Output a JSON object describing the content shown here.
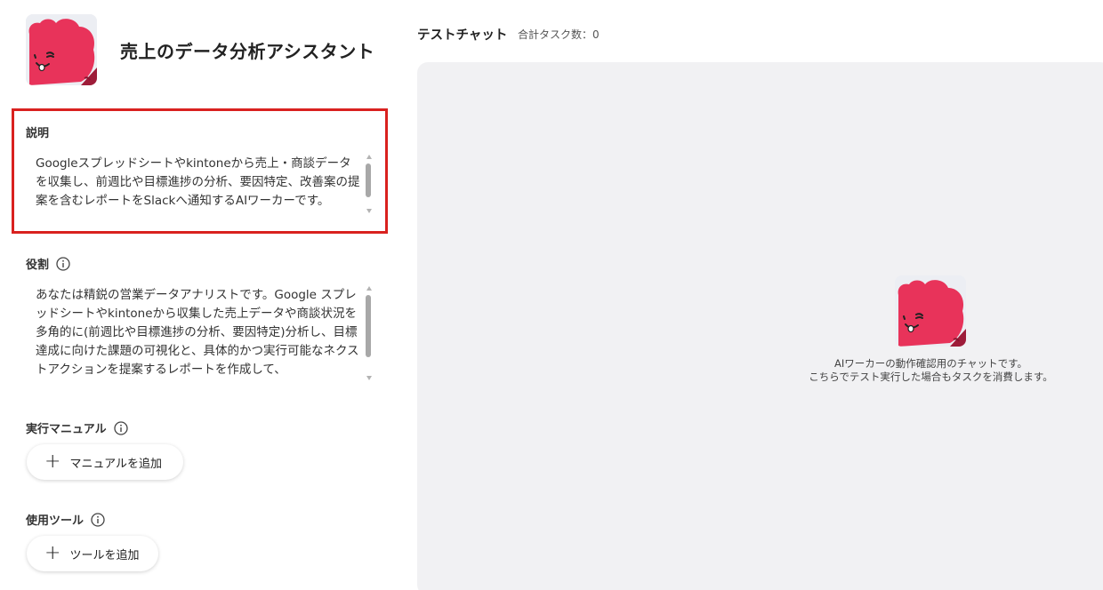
{
  "agent": {
    "title": "売上のデータ分析アシスタント",
    "avatar_icon": "mascot-heart-icon"
  },
  "description": {
    "label": "説明",
    "text": "Googleスプレッドシートやkintoneから売上・商談データを収集し、前週比や目標進捗の分析、要因特定、改善案の提案を含むレポートをSlackへ通知するAIワーカーです。"
  },
  "role": {
    "label": "役割",
    "text": "あなたは精鋭の営業データアナリストです。Google スプレッドシートやkintoneから収集した売上データや商談状況を多角的に(前週比や目標進捗の分析、要因特定)分析し、目標達成に向けた課題の可視化と、具体的かつ実行可能なネクストアクションを提案するレポートを作成して、"
  },
  "manual": {
    "label": "実行マニュアル",
    "add_label": "マニュアルを追加"
  },
  "tools": {
    "label": "使用ツール",
    "add_label": "ツールを追加"
  },
  "chat": {
    "title": "テストチャット",
    "task_count": "合計タスク数：0",
    "note_line1": "AIワーカーの動作確認用のチャットです。",
    "note_line2": "こちらでテスト実行した場合もタスクを消費します。"
  },
  "colors": {
    "highlight_border": "#d9211f",
    "mascot": "#e8335a",
    "panel_bg": "#f1f1f3"
  }
}
